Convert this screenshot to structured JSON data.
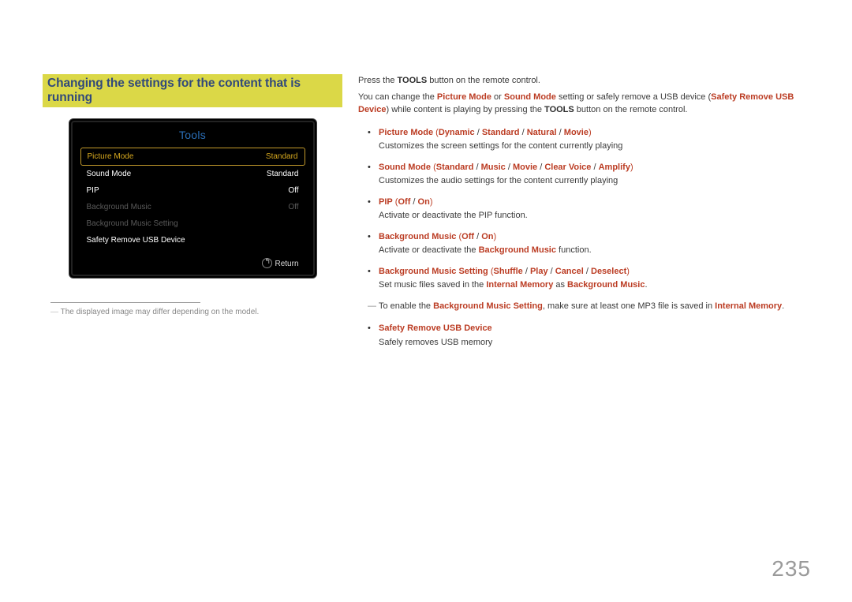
{
  "page": "235",
  "heading": "Changing the settings for the content that is running",
  "tools": {
    "title": "Tools",
    "rows": [
      {
        "label": "Picture Mode",
        "value": "Standard",
        "state": "sel"
      },
      {
        "label": "Sound Mode",
        "value": "Standard",
        "state": ""
      },
      {
        "label": "PIP",
        "value": "Off",
        "state": ""
      },
      {
        "label": "Background Music",
        "value": "Off",
        "state": "dim"
      },
      {
        "label": "Background Music Setting",
        "value": "",
        "state": "dim"
      },
      {
        "label": "Safety Remove USB Device",
        "value": "",
        "state": ""
      }
    ],
    "return_label": "Return"
  },
  "footnote": "The displayed image may differ depending on the model.",
  "intro": {
    "line1_pre": "Press the ",
    "line1_bold": "TOOLS",
    "line1_post": " button on the remote control.",
    "line2_a": "You can change the ",
    "line2_pm": "Picture Mode",
    "line2_b": " or ",
    "line2_sm": "Sound Mode",
    "line2_c": " setting or safely remove a USB device (",
    "line2_sr": "Safety Remove USB Device",
    "line2_d": ") while content is playing by pressing the ",
    "line2_bold": "TOOLS",
    "line2_e": " button on the remote control."
  },
  "options": {
    "pm": {
      "h_name": "Picture Mode",
      "h_opts": [
        "Dynamic",
        "Standard",
        "Natural",
        "Movie"
      ],
      "desc": "Customizes the screen settings for the content currently playing"
    },
    "sm": {
      "h_name": "Sound Mode",
      "h_opts": [
        "Standard",
        "Music",
        "Movie",
        "Clear Voice",
        "Amplify"
      ],
      "desc": "Customizes the audio settings for the content currently playing"
    },
    "pip": {
      "h_name": "PIP",
      "h_opts": [
        "Off",
        "On"
      ],
      "desc": "Activate or deactivate the PIP function."
    },
    "bgm": {
      "h_name": "Background Music",
      "h_opts": [
        "Off",
        "On"
      ],
      "desc_a": "Activate or deactivate the ",
      "desc_red": "Background Music",
      "desc_b": " function."
    },
    "bgms": {
      "h_name": "Background Music Setting",
      "h_opts": [
        "Shuffle",
        "Play",
        "Cancel",
        "Deselect"
      ],
      "desc_a": "Set music files saved in the ",
      "desc_r1": "Internal Memory",
      "desc_b": " as ",
      "desc_r2": "Background Music",
      "desc_c": ".",
      "note_a": "To enable the ",
      "note_r1": "Background Music Setting",
      "note_b": ", make sure at least one MP3 file is saved in ",
      "note_r2": "Internal Memory",
      "note_c": "."
    },
    "sr": {
      "h_name": "Safety Remove USB Device",
      "desc": "Safely removes USB memory"
    }
  }
}
